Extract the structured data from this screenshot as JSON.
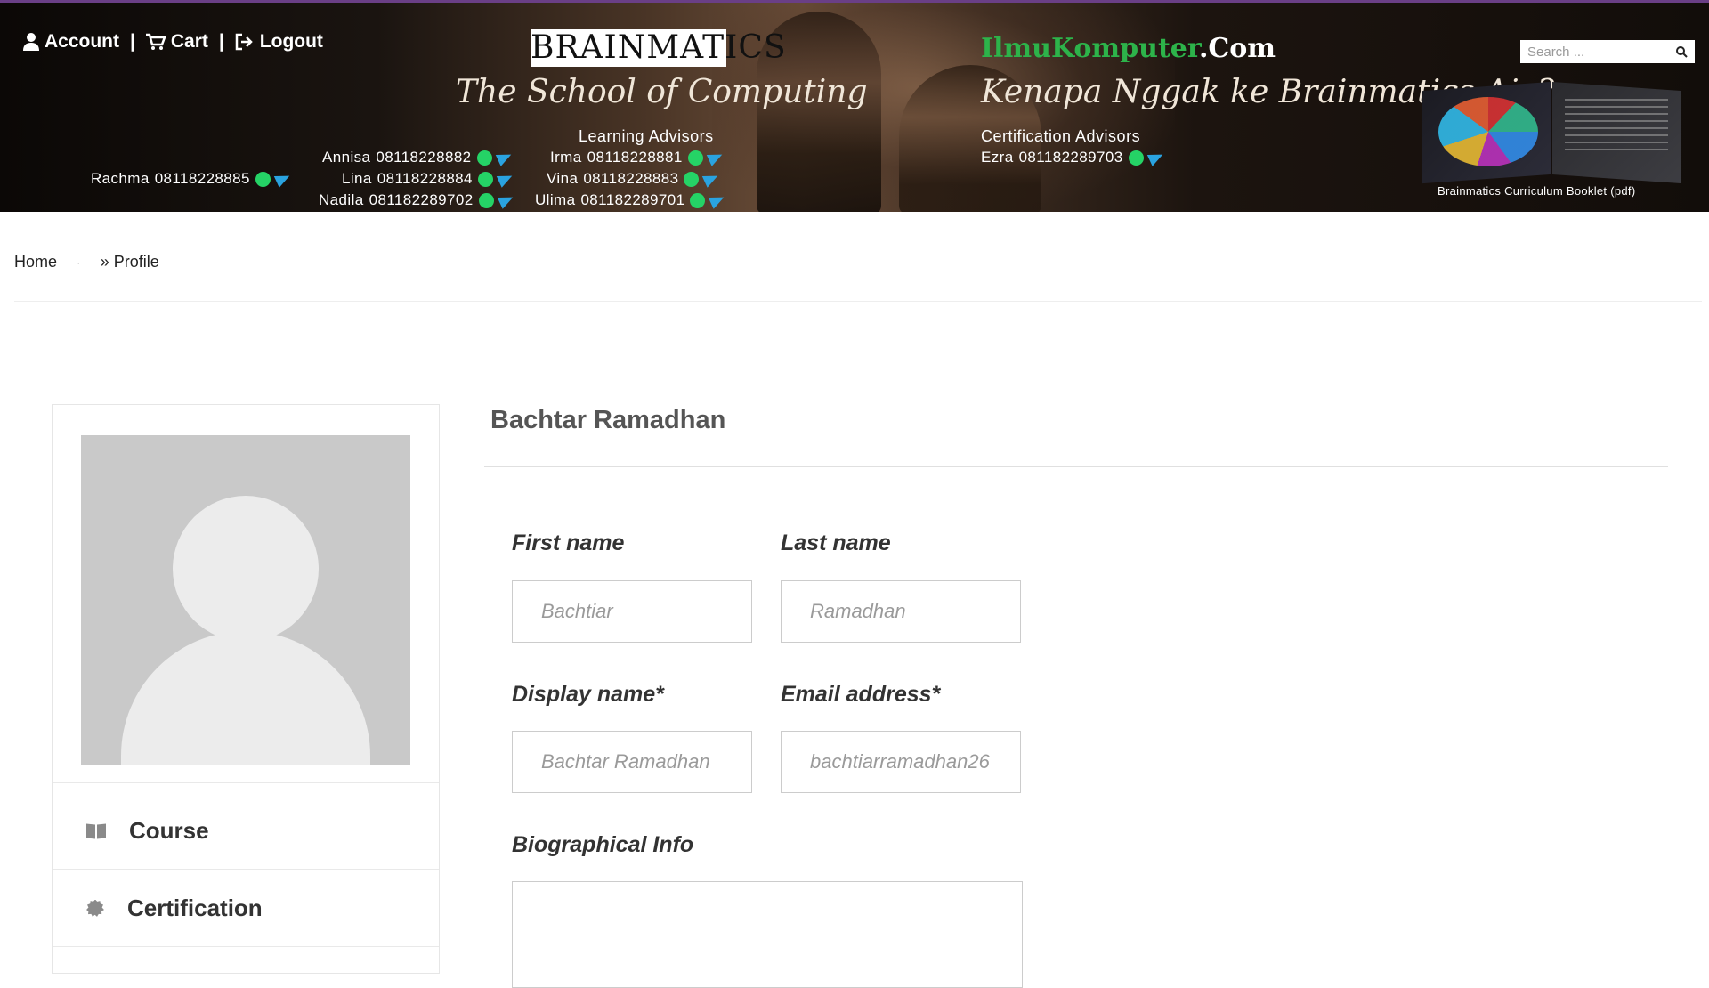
{
  "header": {
    "nav": {
      "account": "Account",
      "cart": "Cart",
      "logout": "Logout",
      "sep": "|"
    },
    "brand_logo": "BRAINMATICS",
    "tagline_left": "The School of Computing",
    "site_green": "IlmuKomputer",
    "site_white": ".Com",
    "tagline_right": "Kenapa Nggak ke Brainmatics Aja?",
    "learning_title": "Learning Advisors",
    "cert_title": "Certification Advisors",
    "advisors": [
      {
        "name": "Rachma",
        "phone": "08118228885"
      },
      {
        "name": "Annisa",
        "phone": "08118228882"
      },
      {
        "name": "Lina",
        "phone": "08118228884"
      },
      {
        "name": "Nadila",
        "phone": "081182289702"
      },
      {
        "name": "Irma",
        "phone": "08118228881"
      },
      {
        "name": "Vina",
        "phone": "08118228883"
      },
      {
        "name": "Ulima",
        "phone": "081182289701"
      },
      {
        "name": "Ezra",
        "phone": "081182289703"
      }
    ],
    "search_placeholder": "Search ...",
    "booklet_caption": "Brainmatics Curriculum Booklet (pdf)",
    "colors": {
      "purple_top": "#6a3f86",
      "whatsapp": "#25d366",
      "telegram": "#2aa3e0",
      "site_green": "#2db34a"
    }
  },
  "breadcrumb": {
    "home": "Home",
    "separator": "·",
    "current": "» Profile"
  },
  "sidebar": {
    "menu": [
      {
        "label": "Course",
        "icon": "book-icon"
      },
      {
        "label": "Certification",
        "icon": "certificate-icon"
      }
    ]
  },
  "profile": {
    "display_title": "Bachtar Ramadhan",
    "first_name": {
      "label": "First name",
      "value": "Bachtiar"
    },
    "last_name": {
      "label": "Last name",
      "value": "Ramadhan"
    },
    "display_name": {
      "label": "Display name*",
      "value": "Bachtar Ramadhan"
    },
    "email": {
      "label": "Email address*",
      "value": "bachtiarramadhan26"
    },
    "bio": {
      "label": "Biographical Info",
      "value": ""
    }
  }
}
